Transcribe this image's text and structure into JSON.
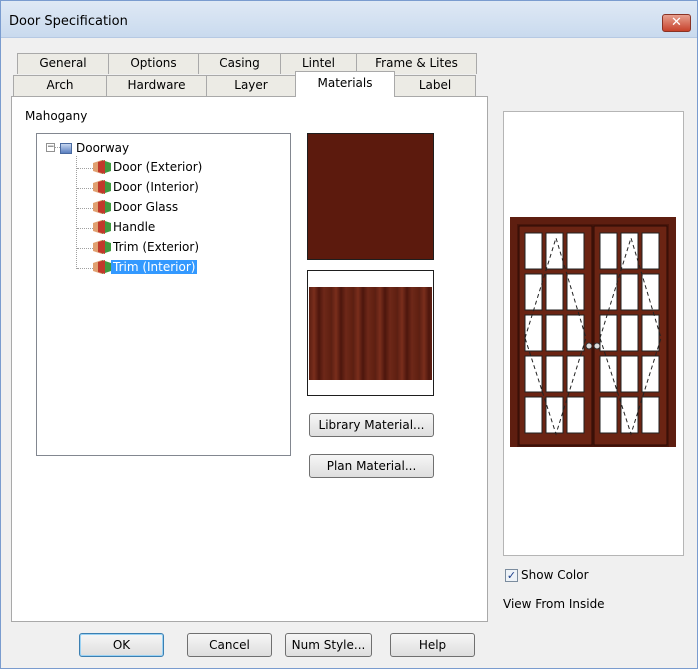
{
  "window": {
    "title": "Door Specification",
    "close_glyph": "✕"
  },
  "tabs_row1": [
    "General",
    "Options",
    "Casing",
    "Lintel",
    "Frame & Lites"
  ],
  "tabs_row2": [
    "Arch",
    "Hardware",
    "Layer",
    "Materials",
    "Label"
  ],
  "active_tab": "Materials",
  "material_name": "Mahogany",
  "tree": {
    "root": "Doorway",
    "expand_glyph": "−",
    "items": [
      "Door (Exterior)",
      "Door (Interior)",
      "Door Glass",
      "Handle",
      "Trim (Exterior)",
      "Trim (Interior)"
    ],
    "selected": "Trim (Interior)"
  },
  "buttons": {
    "library_material": "Library Material...",
    "plan_material": "Plan Material...",
    "ok": "OK",
    "cancel": "Cancel",
    "num_style": "Num Style...",
    "help": "Help"
  },
  "show_color": {
    "label": "Show Color",
    "checked": true,
    "check_glyph": "✓"
  },
  "view_label": "View From Inside",
  "colors": {
    "swatch": "#5c1a0d",
    "selection": "#3399ff",
    "door_frame": "#5e1e10"
  },
  "icons": {
    "close": "close-icon",
    "folder": "folder-icon",
    "material": "material-icon",
    "check": "check-icon"
  }
}
